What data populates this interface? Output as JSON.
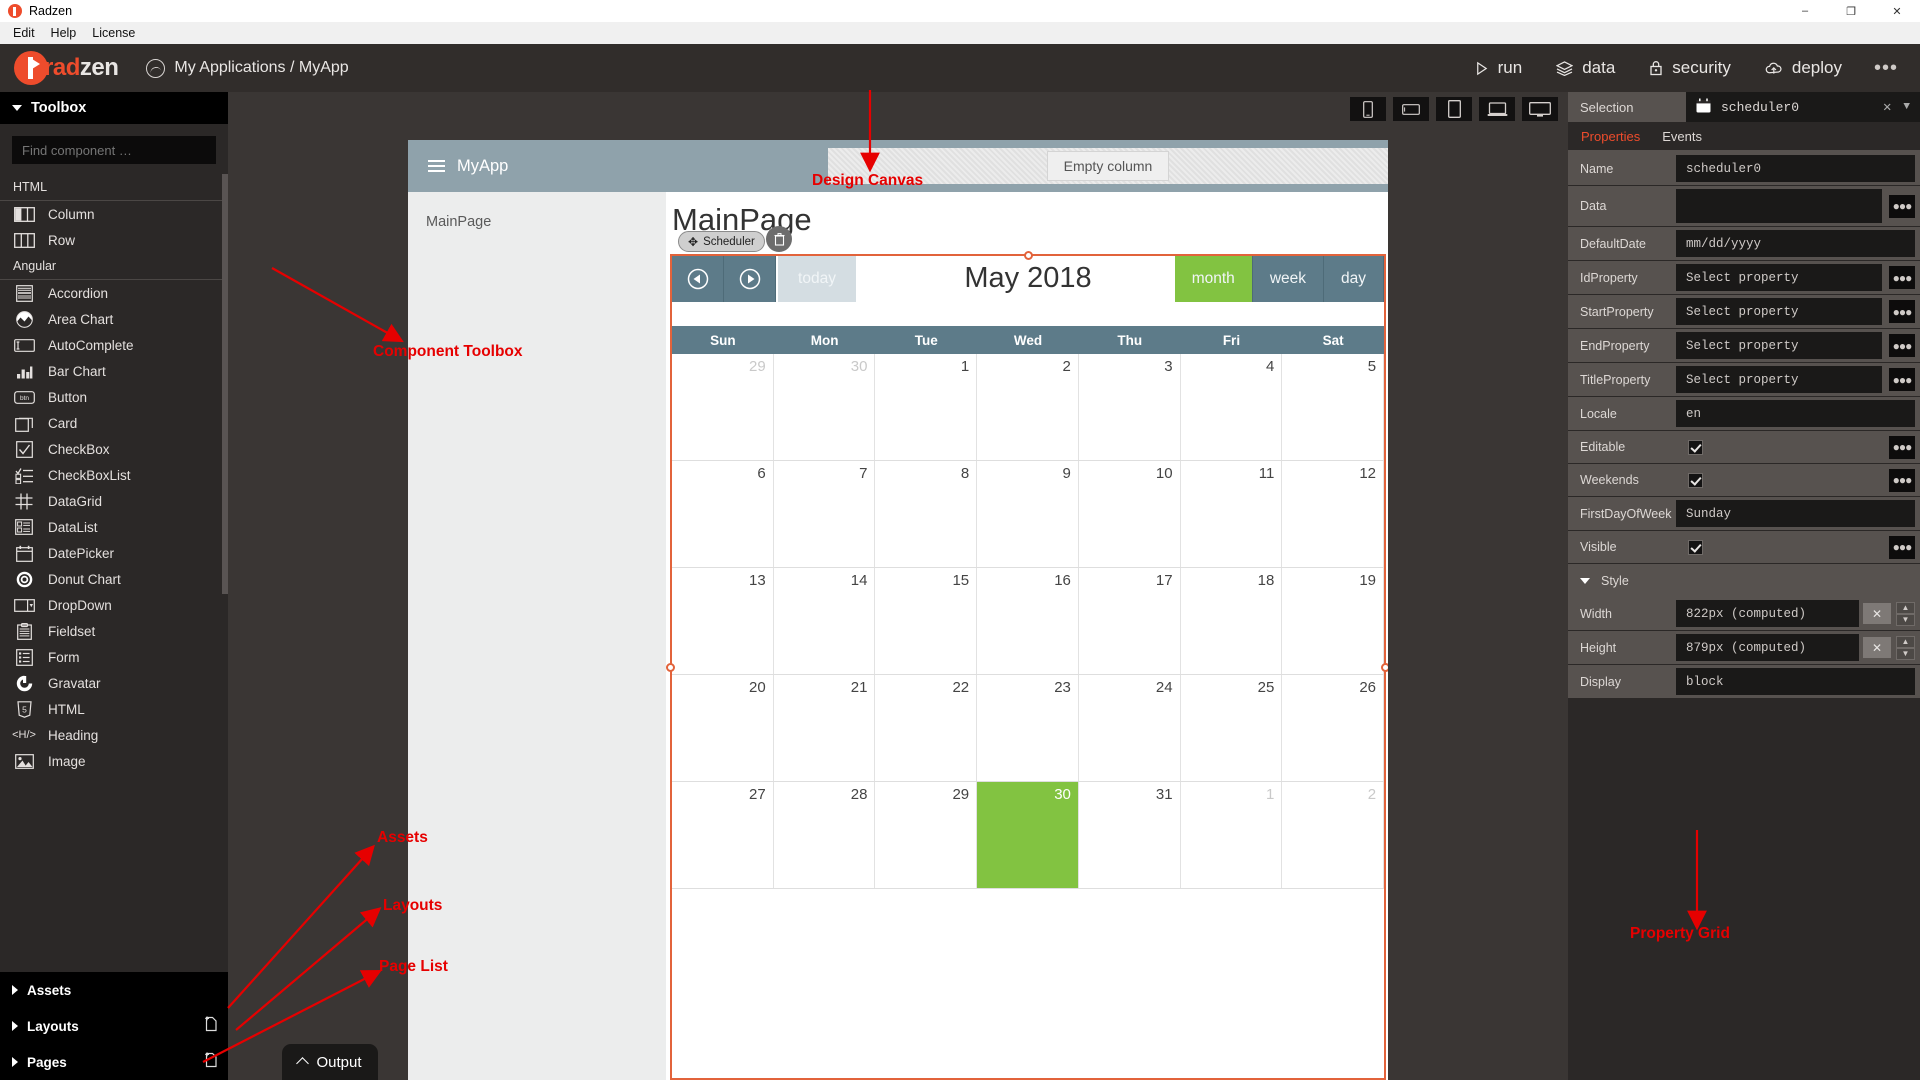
{
  "window": {
    "title": "Radzen",
    "controls": {
      "minimize": "–",
      "maximize": "❐",
      "close": "✕"
    }
  },
  "menubar": {
    "items": [
      "Edit",
      "Help",
      "License"
    ]
  },
  "header": {
    "brand_first": "rad",
    "brand_second": "zen",
    "breadcrumb": "My Applications / MyApp",
    "actions": [
      {
        "label": "run",
        "icon": "play-icon"
      },
      {
        "label": "data",
        "icon": "layers-icon"
      },
      {
        "label": "security",
        "icon": "lock-icon"
      },
      {
        "label": "deploy",
        "icon": "cloud-upload-icon"
      }
    ],
    "more": "•••"
  },
  "toolbox": {
    "title": "Toolbox",
    "search_placeholder": "Find component …",
    "groups": [
      {
        "name": "HTML",
        "items": [
          {
            "label": "Column",
            "icon": "column-icon"
          },
          {
            "label": "Row",
            "icon": "row-icon"
          }
        ]
      },
      {
        "name": "Angular",
        "items": [
          {
            "label": "Accordion",
            "icon": "accordion-icon"
          },
          {
            "label": "Area Chart",
            "icon": "area-chart-icon"
          },
          {
            "label": "AutoComplete",
            "icon": "autocomplete-icon"
          },
          {
            "label": "Bar Chart",
            "icon": "bar-chart-icon"
          },
          {
            "label": "Button",
            "icon": "button-icon"
          },
          {
            "label": "Card",
            "icon": "card-icon"
          },
          {
            "label": "CheckBox",
            "icon": "checkbox-icon"
          },
          {
            "label": "CheckBoxList",
            "icon": "checkboxlist-icon"
          },
          {
            "label": "DataGrid",
            "icon": "datagrid-icon"
          },
          {
            "label": "DataList",
            "icon": "datalist-icon"
          },
          {
            "label": "DatePicker",
            "icon": "datepicker-icon"
          },
          {
            "label": "Donut Chart",
            "icon": "donut-chart-icon"
          },
          {
            "label": "DropDown",
            "icon": "dropdown-icon"
          },
          {
            "label": "Fieldset",
            "icon": "fieldset-icon"
          },
          {
            "label": "Form",
            "icon": "form-icon"
          },
          {
            "label": "Gravatar",
            "icon": "gravatar-icon"
          },
          {
            "label": "HTML",
            "icon": "html5-icon"
          },
          {
            "label": "Heading",
            "icon": "heading-icon"
          },
          {
            "label": "Image",
            "icon": "image-icon"
          }
        ]
      }
    ],
    "sections": [
      {
        "label": "Assets",
        "add": false
      },
      {
        "label": "Layouts",
        "add": true
      },
      {
        "label": "Pages",
        "add": true
      }
    ]
  },
  "devices": [
    {
      "name": "phone-portrait-icon"
    },
    {
      "name": "phone-landscape-icon"
    },
    {
      "name": "tablet-icon"
    },
    {
      "name": "laptop-icon"
    },
    {
      "name": "desktop-icon"
    }
  ],
  "canvas": {
    "app_title": "MyApp",
    "empty_column": "Empty column",
    "side_nav": "MainPage",
    "page_title": "MainPage",
    "component_badge": "Scheduler"
  },
  "scheduler": {
    "prev": "◀",
    "next": "▶",
    "today": "today",
    "month_title": "May 2018",
    "views": [
      {
        "label": "month",
        "active": true
      },
      {
        "label": "week",
        "active": false
      },
      {
        "label": "day",
        "active": false
      }
    ],
    "day_names": [
      "Sun",
      "Mon",
      "Tue",
      "Wed",
      "Thu",
      "Fri",
      "Sat"
    ],
    "weeks": [
      [
        {
          "d": "29",
          "other": true
        },
        {
          "d": "30",
          "other": true
        },
        {
          "d": "1"
        },
        {
          "d": "2"
        },
        {
          "d": "3"
        },
        {
          "d": "4"
        },
        {
          "d": "5"
        }
      ],
      [
        {
          "d": "6"
        },
        {
          "d": "7"
        },
        {
          "d": "8"
        },
        {
          "d": "9"
        },
        {
          "d": "10"
        },
        {
          "d": "11"
        },
        {
          "d": "12"
        }
      ],
      [
        {
          "d": "13"
        },
        {
          "d": "14"
        },
        {
          "d": "15"
        },
        {
          "d": "16"
        },
        {
          "d": "17"
        },
        {
          "d": "18"
        },
        {
          "d": "19"
        }
      ],
      [
        {
          "d": "20"
        },
        {
          "d": "21"
        },
        {
          "d": "22"
        },
        {
          "d": "23"
        },
        {
          "d": "24"
        },
        {
          "d": "25"
        },
        {
          "d": "26"
        }
      ],
      [
        {
          "d": "27"
        },
        {
          "d": "28"
        },
        {
          "d": "29"
        },
        {
          "d": "30",
          "today": true
        },
        {
          "d": "31"
        },
        {
          "d": "1",
          "other": true
        },
        {
          "d": "2",
          "other": true
        }
      ]
    ],
    "today_color": "#82c341",
    "header_color": "#5d7b89",
    "select_outline": "#e2633b"
  },
  "properties": {
    "selection_label": "Selection",
    "selection_value": "scheduler0",
    "tabs": [
      {
        "label": "Properties",
        "active": true
      },
      {
        "label": "Events",
        "active": false
      }
    ],
    "rows": [
      {
        "label": "Name",
        "type": "text",
        "value": "scheduler0",
        "code": false
      },
      {
        "label": "Data",
        "type": "select",
        "value": "",
        "code": true
      },
      {
        "label": "DefaultDate",
        "type": "text",
        "value": "mm/dd/yyyy",
        "code": false
      },
      {
        "label": "IdProperty",
        "type": "select",
        "value": "Select property",
        "code": true
      },
      {
        "label": "StartProperty",
        "type": "select",
        "value": "Select property",
        "code": true
      },
      {
        "label": "EndProperty",
        "type": "select",
        "value": "Select property",
        "code": true
      },
      {
        "label": "TitleProperty",
        "type": "select",
        "value": "Select property",
        "code": true
      },
      {
        "label": "Locale",
        "type": "text",
        "value": "en",
        "code": false
      },
      {
        "label": "Editable",
        "type": "checkbox",
        "value": true,
        "code": true
      },
      {
        "label": "Weekends",
        "type": "checkbox",
        "value": true,
        "code": true
      },
      {
        "label": "FirstDayOfWeek",
        "type": "select",
        "value": "Sunday",
        "code": false
      },
      {
        "label": "Visible",
        "type": "checkbox",
        "value": true,
        "code": true
      }
    ],
    "style_header": "Style",
    "style_rows": [
      {
        "label": "Width",
        "type": "stepper",
        "value": "822px (computed)"
      },
      {
        "label": "Height",
        "type": "stepper",
        "value": "879px (computed)"
      },
      {
        "label": "Display",
        "type": "select",
        "value": "block"
      }
    ]
  },
  "output": {
    "label": "Output"
  },
  "annotations": [
    {
      "text": "Design Canvas"
    },
    {
      "text": "Component Toolbox"
    },
    {
      "text": "Assets"
    },
    {
      "text": "Layouts"
    },
    {
      "text": "Page List"
    },
    {
      "text": "Property Grid"
    }
  ]
}
